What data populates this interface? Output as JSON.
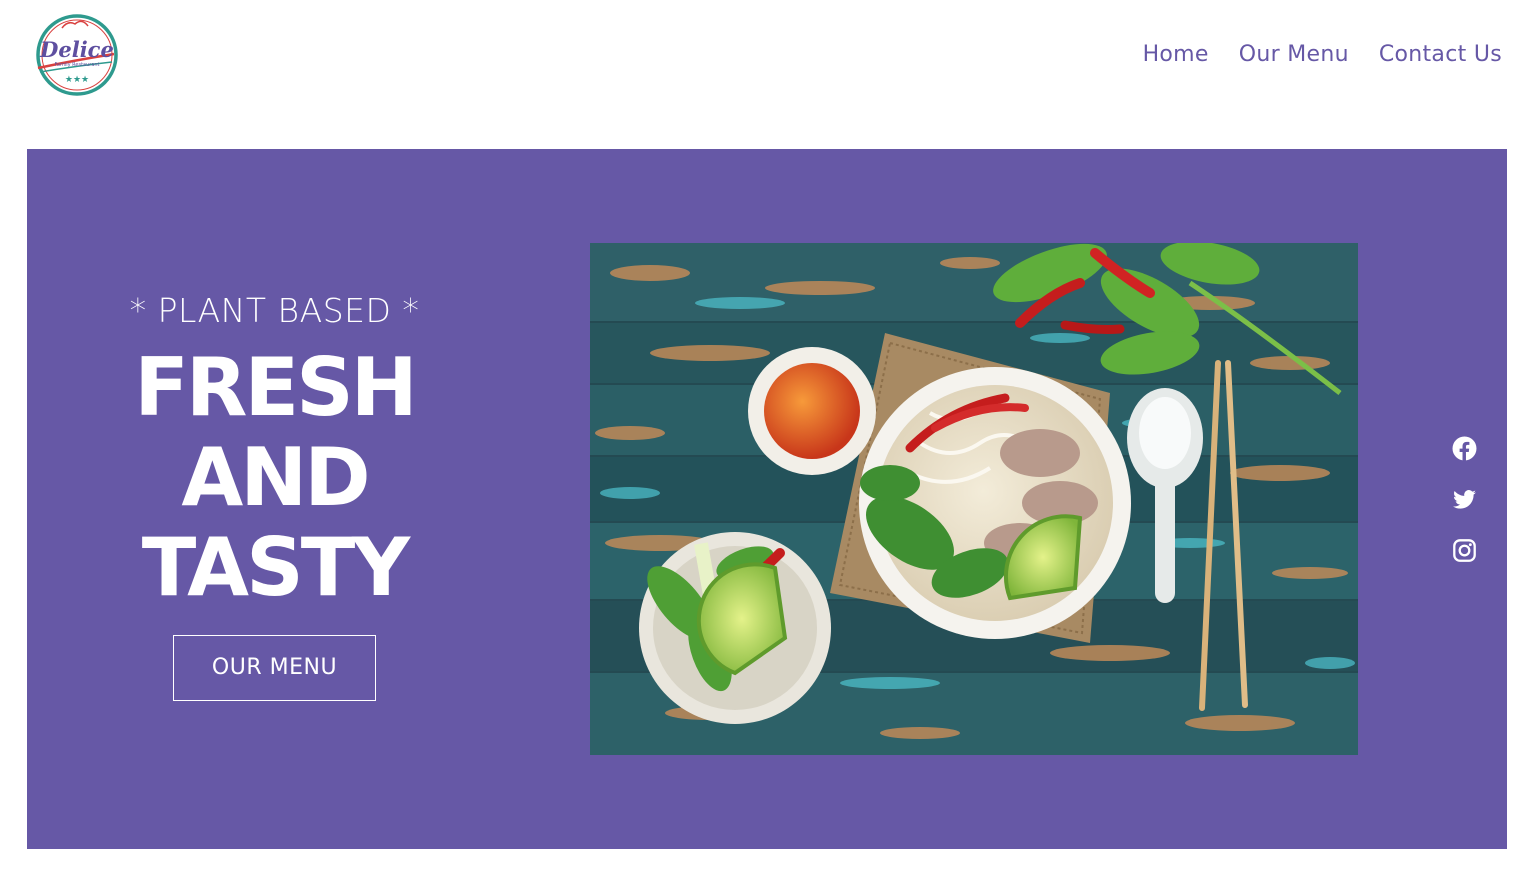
{
  "brand": {
    "name": "Delice",
    "tagline": "Family Restaurant",
    "stars": "★★★"
  },
  "nav": {
    "items": [
      {
        "label": "Home"
      },
      {
        "label": "Our Menu"
      },
      {
        "label": "Contact Us"
      }
    ]
  },
  "hero": {
    "eyebrow": "* PLANT BASED *",
    "headline": [
      "FRESH",
      "AND",
      "TASTY"
    ],
    "cta_label": "OUR MENU",
    "photo_icon": "pho-noodle-soup-photo",
    "background_color": "#6658a6"
  },
  "social": {
    "icons": [
      "facebook-icon",
      "twitter-icon",
      "instagram-icon"
    ]
  },
  "colors": {
    "accent": "#6658a6",
    "logo_teal": "#2e9a8e",
    "logo_red": "#d9413f",
    "text_on_accent": "#ffffff"
  }
}
